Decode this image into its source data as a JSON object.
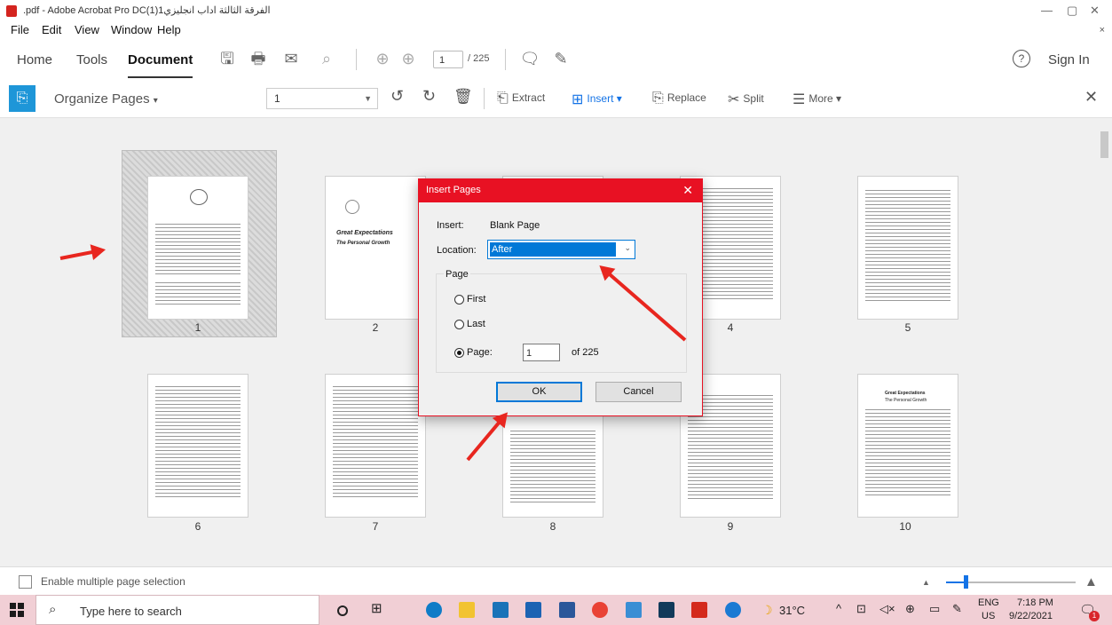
{
  "window": {
    "title": ".pdf - Adobe Acrobat Pro DC(1)الفرقة الثالثة اداب انجليزي1",
    "controls": {
      "minimize": "—",
      "maximize": "▢",
      "close": "✕"
    }
  },
  "menu": [
    "File",
    "Edit",
    "View",
    "Window",
    "Help"
  ],
  "main_toolbar": {
    "tabs": [
      "Home",
      "Tools",
      "Document"
    ],
    "active_tab": "Document",
    "page_current": "1",
    "page_total": "/ 225",
    "help_icon": "?",
    "sign_in": "Sign In"
  },
  "organize": {
    "title": "Organize Pages",
    "title_caret": "▾",
    "page_select_value": "1",
    "extract": "Extract",
    "insert": "Insert",
    "replace": "Replace",
    "split": "Split",
    "more": "More",
    "close": "✕"
  },
  "thumbnails": {
    "row1": [
      "1",
      "2",
      "4",
      "5"
    ],
    "row2": [
      "6",
      "7",
      "8",
      "9",
      "10"
    ],
    "page2_text": [
      "Great Expectations",
      "The Personal Growth"
    ],
    "page10_title": "Great Expectations",
    "page10_sub": "The Personal Growth"
  },
  "dialog": {
    "title": "Insert Pages",
    "close": "✕",
    "insert_label": "Insert:",
    "insert_value": "Blank Page",
    "location_label": "Location:",
    "location_value": "After",
    "group_label": "Page",
    "radio_first": "First",
    "radio_last": "Last",
    "radio_page": "Page:",
    "page_value": "1",
    "of_total": "of 225",
    "ok": "OK",
    "cancel": "Cancel"
  },
  "bottom": {
    "multi_select_label": "Enable multiple page selection"
  },
  "taskbar": {
    "search_placeholder": "Type here to search",
    "weather": "31°C",
    "lang_top": "ENG",
    "lang_bottom": "US",
    "time": "7:18 PM",
    "date": "9/22/2021",
    "notif_count": "1"
  },
  "colors": {
    "accent_red": "#e81123",
    "selection_blue": "#0078d7",
    "acrobat_blue": "#1e96d8",
    "arrow_red": "#e8261f"
  }
}
